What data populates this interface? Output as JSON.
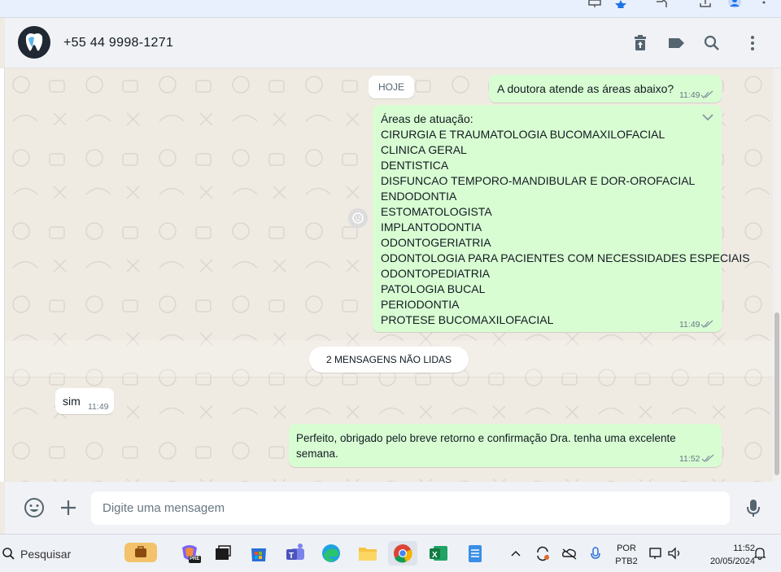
{
  "header": {
    "contact_name": "+55 44 9998-1271",
    "icons": [
      "avatar-logo",
      "delete-icon",
      "label-icon",
      "search-icon",
      "menu-icon"
    ]
  },
  "messages": {
    "date_pill": "HOJE",
    "q1": {
      "text": "A doutora atende as áreas abaixo?",
      "time": "11:49"
    },
    "areas": {
      "title": "Áreas de atuação:",
      "items": [
        "CIRURGIA E TRAUMATOLOGIA BUCOMAXILOFACIAL",
        "CLINICA GERAL",
        "DENTISTICA",
        "DISFUNCAO TEMPORO-MANDIBULAR E DOR-OROFACIAL",
        "ENDODONTIA",
        "ESTOMATOLOGISTA",
        "IMPLANTODONTIA",
        "ODONTOGERIATRIA",
        "ODONTOLOGIA PARA PACIENTES COM NECESSIDADES ESPECIAIS",
        "ODONTOPEDIATRIA",
        "PATOLOGIA BUCAL",
        "PERIODONTIA",
        "PROTESE BUCOMAXILOFACIAL"
      ],
      "time": "11:49"
    },
    "unread_pill": "2 MENSAGENS NÃO LIDAS",
    "reply": {
      "text": "sim",
      "time": "11:49"
    },
    "final": {
      "text": "Perfeito, obrigado pelo breve retorno e confirmação Dra. tenha uma excelente semana.",
      "time": "11:52"
    }
  },
  "compose": {
    "placeholder": "Digite uma mensagem"
  },
  "taskbar": {
    "search_label": "Pesquisar",
    "lang_top": "POR",
    "lang_bottom": "PTB2",
    "clock_time": "11:52",
    "clock_date": "20/05/2024",
    "copilot_badge": "PRE"
  },
  "colors": {
    "outgoing_bubble": "#d9fdd3",
    "incoming_bubble": "#ffffff",
    "chat_background": "#efeae2",
    "tick_blue": "#53bdeb"
  }
}
